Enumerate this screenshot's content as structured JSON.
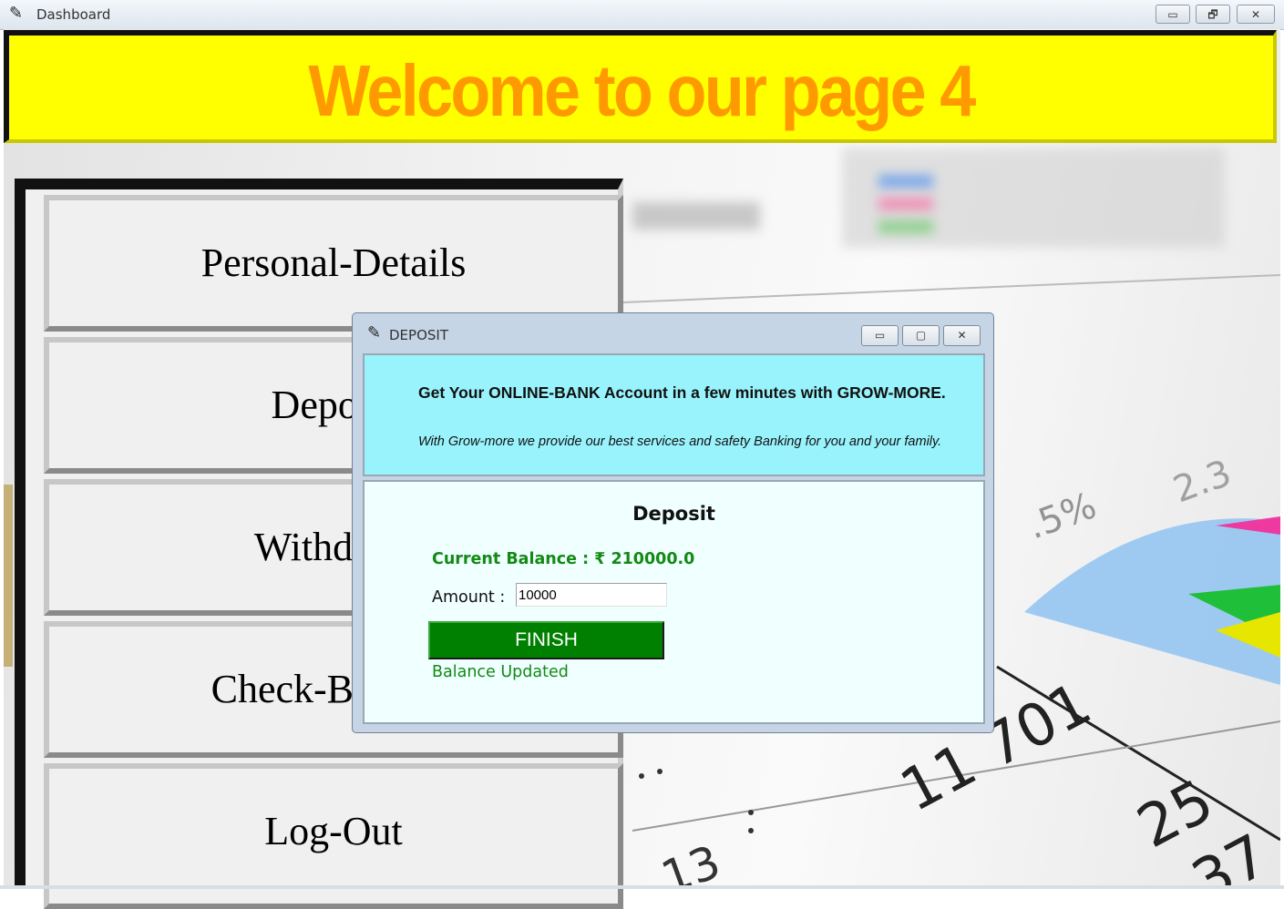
{
  "window": {
    "title": "Dashboard",
    "app_icon": "feather-icon",
    "controls": {
      "minimize": "▭",
      "restore": "🗗",
      "close": "✕"
    }
  },
  "banner": {
    "title": "Welcome to our page 4",
    "bg_color": "#ffff00",
    "text_color": "#ff9900"
  },
  "menu": {
    "items": [
      {
        "label": "Personal-Details"
      },
      {
        "label": "Deposit"
      },
      {
        "label": "Withdraw"
      },
      {
        "label": "Check-Balance"
      },
      {
        "label": "Log-Out"
      }
    ]
  },
  "dialog": {
    "title": "DEPOSIT",
    "app_icon": "feather-icon",
    "controls": {
      "minimize": "▭",
      "maximize": "▢",
      "close": "✕"
    },
    "header": {
      "main": "Get Your ONLINE-BANK Account in a few minutes with GROW-MORE.",
      "sub": "With Grow-more we provide our best services and safety Banking for you and your family.",
      "bg_color": "#99f3fc"
    },
    "body": {
      "title": "Deposit",
      "balance": "Current Balance : ₹ 210000.0",
      "amount_label": "Amount :",
      "amount_value": "10000",
      "finish_label": "FINISH",
      "status": "Balance Updated",
      "accent_color": "#008000"
    }
  },
  "background": {
    "chart_texts": [
      "11 701",
      "25",
      "37",
      ".5%",
      "2.3",
      "13"
    ]
  }
}
